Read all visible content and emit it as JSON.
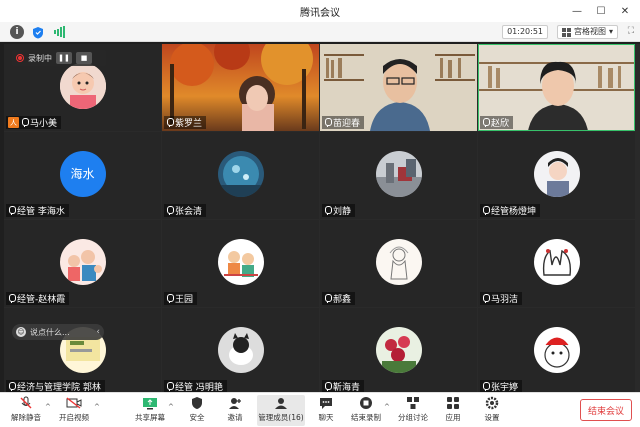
{
  "window": {
    "title": "腾讯会议",
    "controls": [
      "minimize-icon",
      "restore-icon",
      "close-icon"
    ]
  },
  "infobar": {
    "timer": "01:20:51",
    "view_label": "宫格视图",
    "icons": [
      "info-icon",
      "shield-icon",
      "signal-icon",
      "fullscreen-icon"
    ]
  },
  "recording": {
    "label": "录制中"
  },
  "chat": {
    "placeholder": "说点什么..."
  },
  "tiles": [
    {
      "name": "马小美",
      "host": true,
      "type": "photo-baby"
    },
    {
      "name": "紫罗兰",
      "type": "video-autumn"
    },
    {
      "name": "苗迎春",
      "type": "video-man"
    },
    {
      "name": "赵欣",
      "type": "video-woman",
      "active": true
    },
    {
      "name": "经管 李海水",
      "type": "text-avatar",
      "avatar_text": "海水"
    },
    {
      "name": "张会清",
      "type": "photo-aquarium"
    },
    {
      "name": "刘静",
      "type": "photo-street"
    },
    {
      "name": "经管杨燈坤",
      "type": "photo-girl"
    },
    {
      "name": "经管-赵林霞",
      "type": "photo-cartoon-family"
    },
    {
      "name": "王园",
      "type": "photo-cartoon"
    },
    {
      "name": "郝鑫",
      "type": "photo-sketch"
    },
    {
      "name": "马羽洁",
      "type": "photo-hands"
    },
    {
      "name": "经济与管理学院 郭林",
      "type": "photo-card"
    },
    {
      "name": "经管 冯明艳",
      "type": "photo-cat"
    },
    {
      "name": "靳海青",
      "type": "photo-flowers"
    },
    {
      "name": "张宇婷",
      "type": "photo-bird"
    }
  ],
  "toolbar": {
    "unmute": "解除静音",
    "video": "开启视频",
    "share": "共享屏幕",
    "security": "安全",
    "invite": "邀请",
    "members": "管理成员(16)",
    "chat": "聊天",
    "record": "结束录制",
    "breakout": "分组讨论",
    "apps": "应用",
    "settings": "设置",
    "end": "结束会议"
  },
  "colors": {
    "accent_blue": "#1e7ff0",
    "end_red": "#e03a3a",
    "active_green": "#37c26a",
    "host_orange": "#f07b1e"
  }
}
